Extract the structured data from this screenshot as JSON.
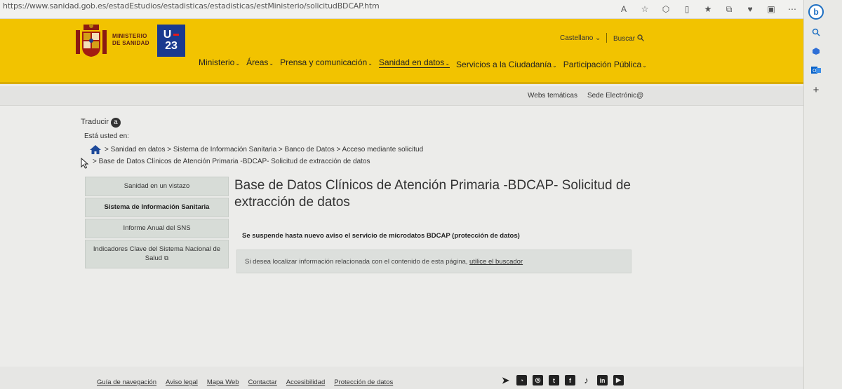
{
  "browser": {
    "url": "https://www.sanidad.gob.es/estadEstudios/estadisticas/estadisticas/estMinisterio/solicitudBDCAP.htm"
  },
  "header": {
    "ministry_line1": "MINISTERIO",
    "ministry_line2": "DE SANIDAD",
    "u23_top": "U",
    "u23_bottom": "23",
    "language": "Castellano ⌄",
    "search": "Buscar",
    "nav": [
      "Ministerio",
      "Áreas",
      "Prensa y comunicación",
      "Sanidad en datos",
      "Servicios a la Ciudadanía",
      "Participación Pública"
    ]
  },
  "subheader": {
    "webs": "Webs temáticas",
    "sede": "Sede Electrónic@"
  },
  "translate": {
    "label": "Traducir",
    "icon_glyph": "a"
  },
  "breadcrumb": {
    "intro": "Está usted en:",
    "line1": "> Sanidad en datos  > Sistema de Información Sanitaria  > Banco de Datos  > Acceso mediante solicitud",
    "line2": "> Base de Datos Clínicos de Atención Primaria -BDCAP- Solicitud de extracción de datos"
  },
  "left_nav": [
    "Sanidad en un vistazo",
    "Sistema de Información Sanitaria",
    "Informe Anual del SNS",
    "Indicadores Clave del Sistema Nacional de Salud"
  ],
  "main": {
    "title": "Base de Datos Clínicos de Atención Primaria -BDCAP- Solicitud de extracción de datos",
    "notice": "Se suspende hasta nuevo aviso el servicio de microdatos BDCAP (protección de datos)",
    "info_text": "Si desea localizar información relacionada con el contenido de esta página,",
    "info_link": "utilice el buscador"
  },
  "footer": {
    "links": [
      "Guía de navegación",
      "Aviso legal",
      "Mapa Web",
      "Contactar",
      "Accesibilidad",
      "Protección de datos"
    ],
    "social_icons": [
      "telegram-icon",
      "rss-icon",
      "instagram-icon",
      "twitter-icon",
      "facebook-icon",
      "tiktok-icon",
      "linkedin-icon",
      "youtube-icon"
    ]
  }
}
